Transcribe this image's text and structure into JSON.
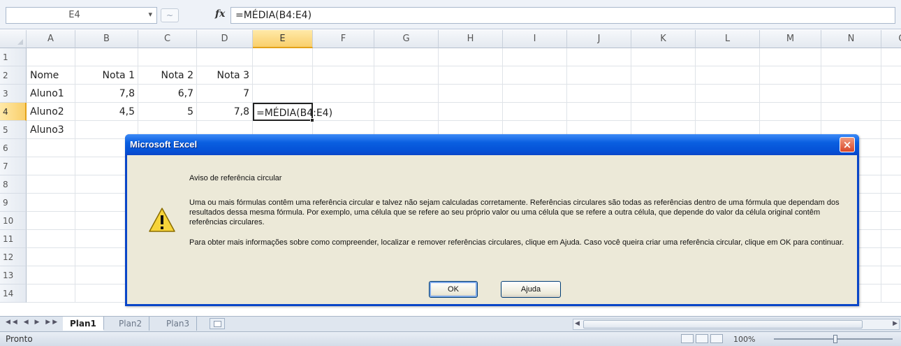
{
  "formula_bar": {
    "name_box": "E4",
    "fx_label": "fx",
    "formula": "=MÉDIA(B4:E4)"
  },
  "columns": [
    "A",
    "B",
    "C",
    "D",
    "E",
    "F",
    "G",
    "H",
    "I",
    "J",
    "K",
    "L",
    "M",
    "N",
    "O"
  ],
  "rows": [
    "1",
    "2",
    "3",
    "4",
    "5",
    "6",
    "7",
    "8",
    "9",
    "10",
    "11",
    "12",
    "13",
    "14"
  ],
  "cells": {
    "A2": "Nome",
    "B2": "Nota 1",
    "C2": "Nota 2",
    "D2": "Nota 3",
    "A3": "Aluno1",
    "B3": "7,8",
    "C3": "6,7",
    "D3": "7",
    "A4": "Aluno2",
    "B4": "4,5",
    "C4": "5",
    "D4": "7,8",
    "E4": "=MÉDIA(B4:E4)",
    "A5": "Aluno3"
  },
  "sheet_tabs": [
    "Plan1",
    "Plan2",
    "Plan3"
  ],
  "status": {
    "text": "Pronto",
    "zoom": "100%"
  },
  "dialog": {
    "title": "Microsoft Excel",
    "close": "×",
    "heading": "Aviso de referência circular",
    "paragraph1": "Uma ou mais fórmulas contêm uma referência circular e talvez não sejam calculadas corretamente. Referências circulares são todas as referências dentro de uma fórmula que dependam dos resultados dessa mesma fórmula. Por exemplo, uma célula que se refere ao seu próprio valor ou uma célula que se refere a outra célula, que depende do valor da célula original contêm referências circulares.",
    "paragraph2": "Para obter mais informações sobre como compreender, localizar e remover referências circulares, clique em Ajuda. Caso você queira criar uma referência circular, clique em OK para continuar.",
    "ok_label": "OK",
    "help_label": "Ajuda"
  }
}
